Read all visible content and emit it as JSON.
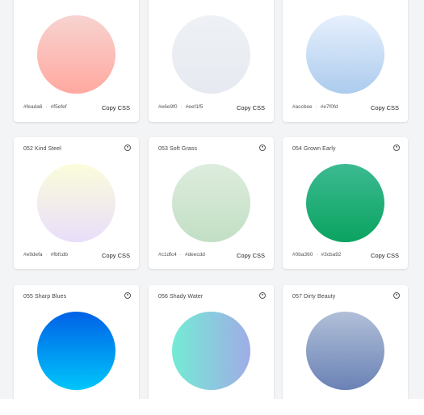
{
  "cards": [
    {
      "title": "",
      "c1": "#fcbcb8",
      "c2": "#ffa99f",
      "hex1": "#feada6",
      "hex2": "#f5efef",
      "copy": "Copy CSS"
    },
    {
      "title": "",
      "c1": "#eceff3",
      "c2": "#e6e9f0",
      "hex1": "#e6e9f0",
      "hex2": "#eef1f5",
      "copy": "Copy CSS"
    },
    {
      "title": "",
      "c1": "#e1ecfb",
      "c2": "#acc8ee",
      "hex1": "#accbee",
      "hex2": "#e7f0fd",
      "copy": "Copy CSS"
    },
    {
      "title": "052 Kind Steel",
      "c1": "#f9f7df",
      "c2": "#e8e0f3",
      "hex1": "#e9defa",
      "hex2": "#fbfcdb",
      "copy": "Copy CSS"
    },
    {
      "title": "053 Soft Grass",
      "c1": "#dbeedd",
      "c2": "#c5e3c8",
      "hex1": "#c1dfc4",
      "hex2": "#deecdd",
      "copy": "Copy CSS"
    },
    {
      "title": "054 Grown Early",
      "c1": "#3cba92",
      "c2": "#0ba360",
      "hex1": "#0ba360",
      "hex2": "#3cba92",
      "copy": "Copy CSS"
    },
    {
      "title": "055 Sharp Blues",
      "c1": "#0061e6",
      "c2": "#00c6fb",
      "hex1": "",
      "hex2": "",
      "copy": ""
    },
    {
      "title": "056 Shady Water",
      "c1": "#74ebd5",
      "c2": "#9face6",
      "hex1": "",
      "hex2": "",
      "copy": ""
    },
    {
      "title": "057 Dirty Beauty",
      "c1": "#b1bfd8",
      "c2": "#6a82b5",
      "hex1": "",
      "hex2": "",
      "copy": ""
    }
  ],
  "icons": {
    "download": "download-circle-icon"
  }
}
